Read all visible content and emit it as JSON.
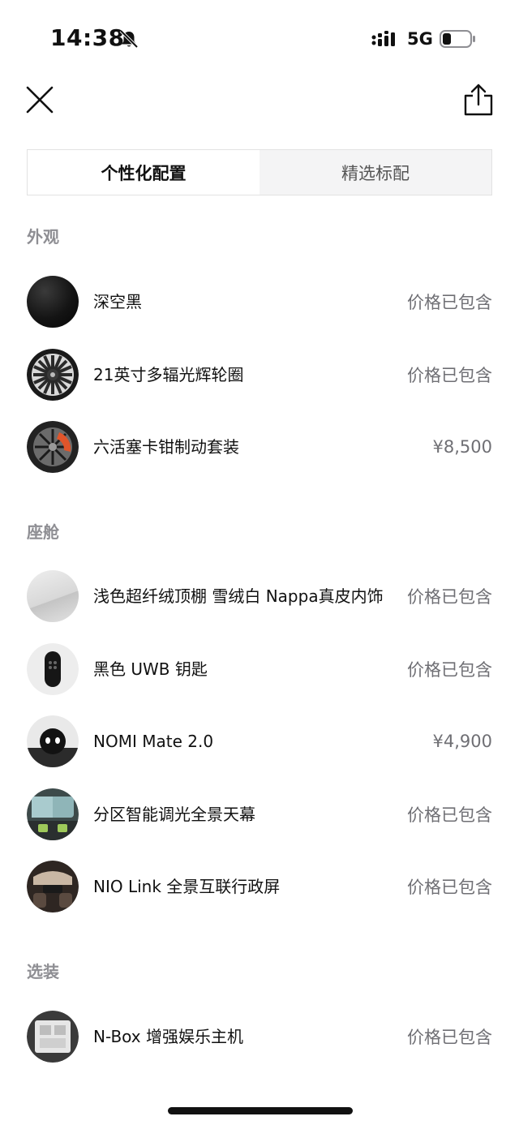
{
  "status_bar": {
    "time": "14:38",
    "network": "5G",
    "icons": [
      "bell-slash-icon",
      "signal-icon",
      "battery-icon"
    ]
  },
  "header": {
    "close_icon": "close-icon",
    "share_icon": "share-icon"
  },
  "tabs": [
    {
      "label": "个性化配置",
      "active": true
    },
    {
      "label": "精选标配",
      "active": false
    }
  ],
  "sections": [
    {
      "title": "外观",
      "items": [
        {
          "label": "深空黑",
          "price": "价格已包含"
        },
        {
          "label": "21英寸多辐光辉轮圈",
          "price": "价格已包含"
        },
        {
          "label": "六活塞卡钳制动套装",
          "price": "¥8,500"
        }
      ]
    },
    {
      "title": "座舱",
      "items": [
        {
          "label": "浅色超纤绒顶棚 雪绒白 Nappa真皮内饰",
          "price": "价格已包含"
        },
        {
          "label": "黑色 UWB 钥匙",
          "price": "价格已包含"
        },
        {
          "label": "NOMI Mate 2.0",
          "price": "¥4,900"
        },
        {
          "label": "分区智能调光全景天幕",
          "price": "价格已包含"
        },
        {
          "label": "NIO Link 全景互联行政屏",
          "price": "价格已包含"
        }
      ]
    },
    {
      "title": "选装",
      "items": [
        {
          "label": "N-Box 增强娱乐主机",
          "price": "价格已包含"
        }
      ]
    }
  ],
  "colors": {
    "text_primary": "#111111",
    "text_secondary": "#6f6f74",
    "section_title": "#8e8e93",
    "segment_bg": "#f4f4f5"
  }
}
